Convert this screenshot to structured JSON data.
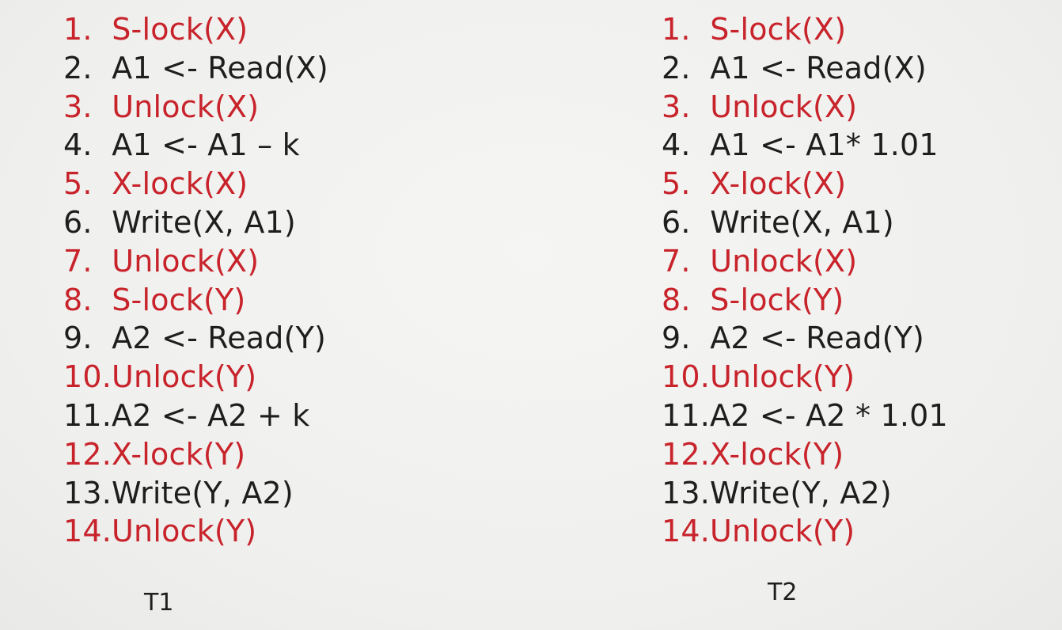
{
  "t1": {
    "label": "T1",
    "steps": [
      {
        "text": "1.  S-lock(X)",
        "kind": "lock"
      },
      {
        "text": "2.  A1 <- Read(X)",
        "kind": "op"
      },
      {
        "text": "3.  Unlock(X)",
        "kind": "lock"
      },
      {
        "text": "4.  A1 <- A1 – k",
        "kind": "op"
      },
      {
        "text": "5.  X-lock(X)",
        "kind": "lock"
      },
      {
        "text": "6.  Write(X, A1)",
        "kind": "op"
      },
      {
        "text": "7.  Unlock(X)",
        "kind": "lock"
      },
      {
        "text": "8.  S-lock(Y)",
        "kind": "lock"
      },
      {
        "text": "9.  A2 <- Read(Y)",
        "kind": "op"
      },
      {
        "text": "10.Unlock(Y)",
        "kind": "lock"
      },
      {
        "text": "11.A2 <- A2 + k",
        "kind": "op"
      },
      {
        "text": "12.X-lock(Y)",
        "kind": "lock"
      },
      {
        "text": "13.Write(Y, A2)",
        "kind": "op"
      },
      {
        "text": "14.Unlock(Y)",
        "kind": "lock"
      }
    ]
  },
  "t2": {
    "label": "T2",
    "steps": [
      {
        "text": "1.  S-lock(X)",
        "kind": "lock"
      },
      {
        "text": "2.  A1 <- Read(X)",
        "kind": "op"
      },
      {
        "text": "3.  Unlock(X)",
        "kind": "lock"
      },
      {
        "text": "4.  A1 <- A1* 1.01",
        "kind": "op"
      },
      {
        "text": "5.  X-lock(X)",
        "kind": "lock"
      },
      {
        "text": "6.  Write(X, A1)",
        "kind": "op"
      },
      {
        "text": "7.  Unlock(X)",
        "kind": "lock"
      },
      {
        "text": "8.  S-lock(Y)",
        "kind": "lock"
      },
      {
        "text": "9.  A2 <- Read(Y)",
        "kind": "op"
      },
      {
        "text": "10.Unlock(Y)",
        "kind": "lock"
      },
      {
        "text": "11.A2 <- A2 * 1.01",
        "kind": "op"
      },
      {
        "text": "12.X-lock(Y)",
        "kind": "lock"
      },
      {
        "text": "13.Write(Y, A2)",
        "kind": "op"
      },
      {
        "text": "14.Unlock(Y)",
        "kind": "lock"
      }
    ]
  },
  "colors": {
    "lock": "#c8232b",
    "op": "#1e1e1e",
    "background": "#f1f1ef"
  }
}
